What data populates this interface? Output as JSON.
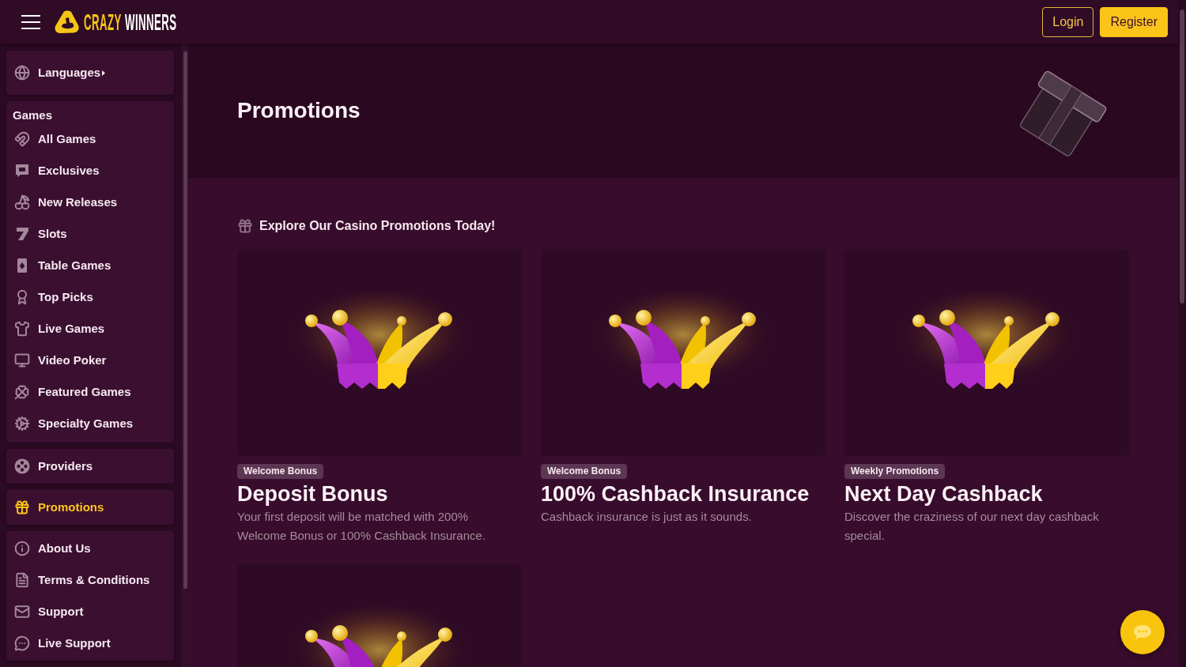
{
  "header": {
    "logo": {
      "words": [
        "CRAZY",
        "WINNERS"
      ]
    },
    "buttons": [
      {
        "label": "Login",
        "kind": "outline"
      },
      {
        "label": "Register",
        "kind": "filled"
      }
    ]
  },
  "sidebar": {
    "groups": [
      {
        "items": [
          {
            "label": "Languages",
            "kind": "submenu",
            "selected": false
          }
        ]
      },
      {
        "heading": "Games",
        "items": [
          {
            "label": "All Games",
            "kind": "link",
            "selected": false
          },
          {
            "label": "Exclusives",
            "kind": "link",
            "selected": false
          },
          {
            "label": "New Releases",
            "kind": "link",
            "selected": false
          },
          {
            "label": "Slots",
            "kind": "link",
            "selected": false
          },
          {
            "label": "Table Games",
            "kind": "link",
            "selected": false
          },
          {
            "label": "Top Picks",
            "kind": "link",
            "selected": false
          },
          {
            "label": "Live Games",
            "kind": "link",
            "selected": false
          },
          {
            "label": "Video Poker",
            "kind": "link",
            "selected": false
          },
          {
            "label": "Featured Games",
            "kind": "link",
            "selected": false
          },
          {
            "label": "Specialty Games",
            "kind": "link",
            "selected": false
          }
        ]
      },
      {
        "items": [
          {
            "label": "Providers",
            "kind": "link",
            "selected": false
          }
        ]
      },
      {
        "items": [
          {
            "label": "Promotions",
            "kind": "link",
            "selected": true
          }
        ]
      },
      {
        "items": [
          {
            "label": "About Us",
            "kind": "link",
            "selected": false
          },
          {
            "label": "Terms & Conditions",
            "kind": "link",
            "selected": false
          },
          {
            "label": "Support",
            "kind": "link",
            "selected": false
          },
          {
            "label": "Live Support",
            "kind": "link",
            "selected": false
          }
        ]
      }
    ]
  },
  "hero": {
    "title": "Promotions"
  },
  "promotions": {
    "heading": "Explore Our Casino Promotions Today!",
    "cards": [
      {
        "kind": "full",
        "tag": "Welcome Bonus",
        "title": "Deposit Bonus",
        "description": "Your first deposit will be matched with 200% Welcome Bonus or 100% Cashback Insurance."
      },
      {
        "kind": "full",
        "tag": "Welcome Bonus",
        "title": "100% Cashback Insurance",
        "description": "Cashback insurance is just as it sounds."
      },
      {
        "kind": "full",
        "tag": "Weekly Promotions",
        "title": "Next Day Cashback",
        "description": "Discover the craziness of our next day cashback special."
      },
      {
        "kind": "image"
      }
    ]
  }
}
